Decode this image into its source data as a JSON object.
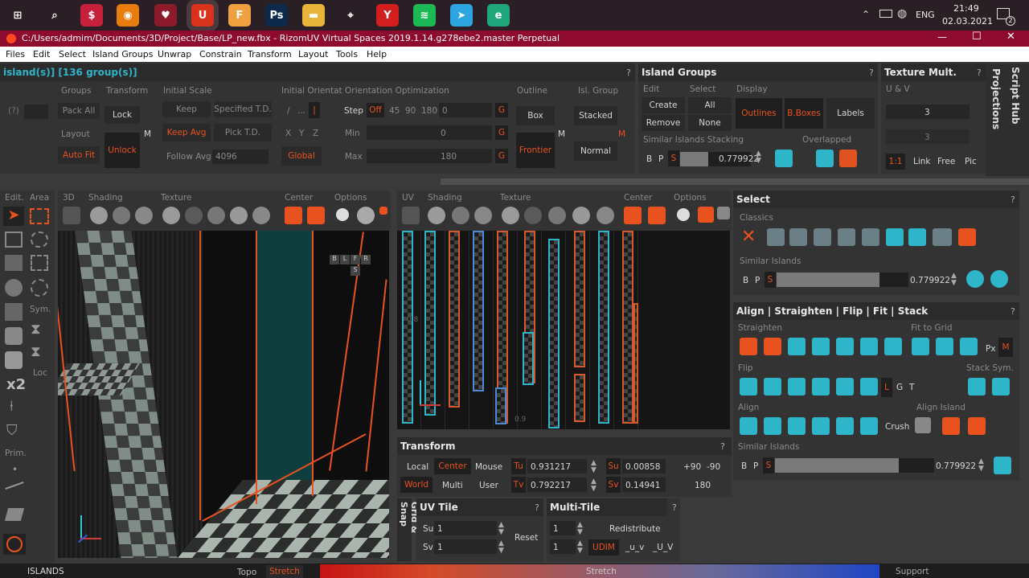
{
  "taskbar": {
    "time": "21:49",
    "date": "02.03.2021",
    "language": "ENG",
    "notif_count": "2",
    "apps": [
      {
        "name": "start-icon",
        "bg": "#2a1f24",
        "glyph": "⊞"
      },
      {
        "name": "search-icon",
        "bg": "#2a1f24",
        "glyph": "⌕"
      },
      {
        "name": "app-s-icon",
        "bg": "#c7203b",
        "glyph": "$"
      },
      {
        "name": "blender-icon",
        "bg": "#e87d0d",
        "glyph": "◉"
      },
      {
        "name": "app-heart-icon",
        "bg": "#8b1a2a",
        "glyph": "♥"
      },
      {
        "name": "rizomuv-icon",
        "bg": "#d9341b",
        "glyph": "U"
      },
      {
        "name": "app-f-icon",
        "bg": "#f0a040",
        "glyph": "F"
      },
      {
        "name": "photoshop-icon",
        "bg": "#0d2a4a",
        "glyph": "Ps"
      },
      {
        "name": "explorer-icon",
        "bg": "#e8b43a",
        "glyph": "▬"
      },
      {
        "name": "app-location-icon",
        "bg": "#2a1f24",
        "glyph": "⌖"
      },
      {
        "name": "yandex-icon",
        "bg": "#d21e1e",
        "glyph": "Y"
      },
      {
        "name": "spotify-icon",
        "bg": "#1db954",
        "glyph": "≋"
      },
      {
        "name": "telegram-icon",
        "bg": "#2ca5e0",
        "glyph": "➤"
      },
      {
        "name": "app-e-icon",
        "bg": "#1fa67a",
        "glyph": "e"
      }
    ]
  },
  "window": {
    "title": "C:/Users/admim/Documents/3D/Project/Base/LP_new.fbx - RizomUV  Virtual Spaces 2019.1.14.g278ebe2.master Perpetual"
  },
  "menu": [
    "Files",
    "Edit",
    "Select",
    "Island Groups",
    "Unwrap",
    "Constrain",
    "Transform",
    "Layout",
    "Tools",
    "Help"
  ],
  "top_left": {
    "header": "island(s)] [136 group(s)]",
    "groups_label": "Groups",
    "pack_all": "Pack All",
    "layout_label": "Layout",
    "auto_fit": "Auto Fit",
    "left_value": "(?)",
    "transform_label": "Transform",
    "lock": "Lock",
    "unlock": "Unlock",
    "m": "M",
    "initial_scale_label": "Initial Scale",
    "keep": "Keep",
    "specified_td": "Specified T.D.",
    "keep_avg": "Keep Avg",
    "pick_td": "Pick T.D.",
    "follow_avg": "Follow Avg",
    "follow_value": "4096",
    "initial_orient_label": "Initial Orientat",
    "orient_slash": "/",
    "orient_dots": "...",
    "orient_bar": "|",
    "x": "X",
    "y": "Y",
    "z": "Z",
    "global": "Global",
    "orient_opt_label": "Orientation Optimization",
    "step": "Step",
    "off": "Off",
    "step_values": [
      "45",
      "90",
      "180"
    ],
    "step_field": "0",
    "min": "Min",
    "min_field": "0",
    "max": "Max",
    "max_field": "180",
    "g": "G",
    "outline_label": "Outline",
    "box": "Box",
    "frontier": "Frontier",
    "isl_group_label": "Isl. Group",
    "stacked": "Stacked",
    "normal": "Normal"
  },
  "island_groups": {
    "title": "Island Groups",
    "edit": "Edit",
    "select": "Select",
    "display": "Display",
    "create": "Create",
    "remove": "Remove",
    "all": "All",
    "none": "None",
    "outlines": "Outlines",
    "bboxes": "B.Boxes",
    "labels": "Labels",
    "similar_stacking": "Similar Islands Stacking",
    "overlapped": "Overlapped",
    "b": "B",
    "p": "P",
    "s": "S",
    "value": "0.779922"
  },
  "texture_mult": {
    "title": "Texture Mult.",
    "uv_label": "U & V",
    "u_value": "3",
    "v_value": "3",
    "ratio": "1:1",
    "link": "Link",
    "free": "Free",
    "pic": "Pic"
  },
  "side_tabs": {
    "projections": "Projections",
    "script_hub": "Script Hub"
  },
  "toolbar3d": {
    "edit": "Edit.",
    "area": "Area",
    "label3d": "3D",
    "shading": "Shading",
    "texture": "Texture",
    "center": "Center",
    "options": "Options",
    "sym": "Sym.",
    "loc": "Loc",
    "x2": "x2",
    "prim": "Prim.",
    "gizmo": [
      "B",
      "L",
      "F",
      "R",
      "S"
    ]
  },
  "toolbar_uv": {
    "uv": "UV",
    "shading": "Shading",
    "texture": "Texture",
    "center": "Center",
    "options": "Options",
    "tick_label": "0.8",
    "tick_bottom": "0.9"
  },
  "select_panel": {
    "title": "Select",
    "classics": "Classics",
    "similar_islands": "Similar Islands",
    "b": "B",
    "p": "P",
    "s": "S",
    "value": "0.779922"
  },
  "align_panel": {
    "title": "Align | Straighten | Flip | Fit | Stack",
    "straighten": "Straighten",
    "fit_to_grid": "Fit to Grid",
    "px": "Px",
    "m": "M",
    "flip": "Flip",
    "stack_sym": "Stack Sym.",
    "l": "L",
    "g": "G",
    "t": "T",
    "align": "Align",
    "crush": "Crush",
    "align_island": "Align Island",
    "similar_islands": "Similar Islands",
    "b": "B",
    "p": "P",
    "s": "S",
    "value": "0.779922"
  },
  "transform_panel": {
    "title": "Transform",
    "local": "Local",
    "center": "Center",
    "mouse": "Mouse",
    "world": "World",
    "multi": "Multi",
    "user": "User",
    "tu": "Tu",
    "tu_value": "0.931217",
    "tv": "Tv",
    "tv_value": "0.792217",
    "su": "Su",
    "su_value": "0.00858",
    "sv": "Sv",
    "sv_value": "0.14941",
    "plus90": "+90",
    "minus90": "-90",
    "r180": "180"
  },
  "grid_snap": "Grid & Snap",
  "uv_tile": {
    "title": "UV Tile",
    "su": "Su",
    "su_value": "1",
    "sv": "Sv",
    "sv_value": "1",
    "reset": "Reset"
  },
  "multi_tile": {
    "title": "Multi-Tile",
    "v1": "1",
    "v2": "1",
    "redistribute": "Redistribute",
    "udim": "UDIM",
    "u_v1": "_u_v",
    "u_v2": "_U_V"
  },
  "status": {
    "islands": "ISLANDS",
    "topo": "Topo",
    "stretch_btn": "Stretch",
    "stretch": "Stretch",
    "support": "Support"
  },
  "question": "?"
}
